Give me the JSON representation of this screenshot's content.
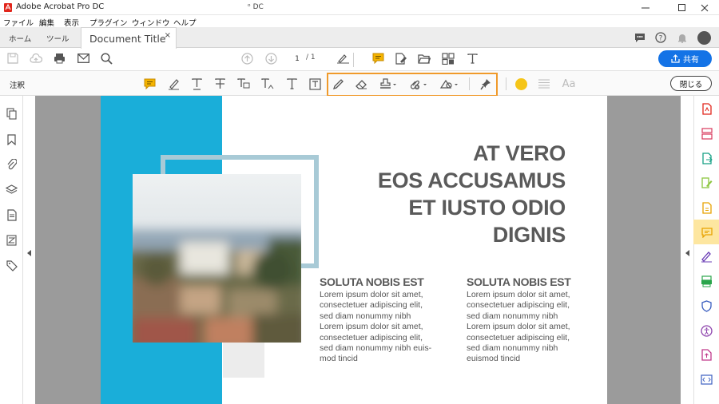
{
  "window": {
    "app_title": "Adobe Acrobat Pro DC",
    "doc_title_center": "ᵒ DC",
    "controls": [
      "minimize",
      "maximize",
      "close"
    ]
  },
  "menu": [
    "ファイル",
    "編集",
    "表示",
    "プラグイン",
    "ウィンドウ",
    "ヘルプ"
  ],
  "tabs": {
    "home": "ホーム",
    "tools": "ツール",
    "document": "Document Title",
    "close_glyph": "×"
  },
  "toolbar": {
    "page_current": "1",
    "page_total": "/ 1",
    "share_label": "共有"
  },
  "commentbar": {
    "label": "注釈",
    "close_label": "閉じる",
    "font_label": "Aa",
    "color": "#f5c518"
  },
  "document": {
    "headline": [
      "AT VERO",
      "EOS ACCUSAMUS",
      "ET IUSTO ODIO",
      "DIGNIS"
    ],
    "columns": [
      {
        "heading": "SOLUTA NOBIS EST",
        "body": "Lorem ipsum dolor sit amet,\nconsectetuer adipiscing elit,\nsed diam nonummy nibh\nLorem ipsum dolor sit amet,\nconsectetuer adipiscing elit,\nsed diam nonummy nibh euis-\nmod tincid"
      },
      {
        "heading": "SOLUTA NOBIS EST",
        "body": "Lorem ipsum dolor sit amet,\nconsectetuer adipiscing elit,\nsed diam nonummy nibh\nLorem ipsum dolor sit amet,\nconsectetuer adipiscing elit,\nsed diam nonummy nibh\neuismod tincid"
      }
    ]
  },
  "colors": {
    "accent_blue": "#1473e6",
    "page_blue": "#1aaed9",
    "highlight_orange": "#f09a2b"
  }
}
